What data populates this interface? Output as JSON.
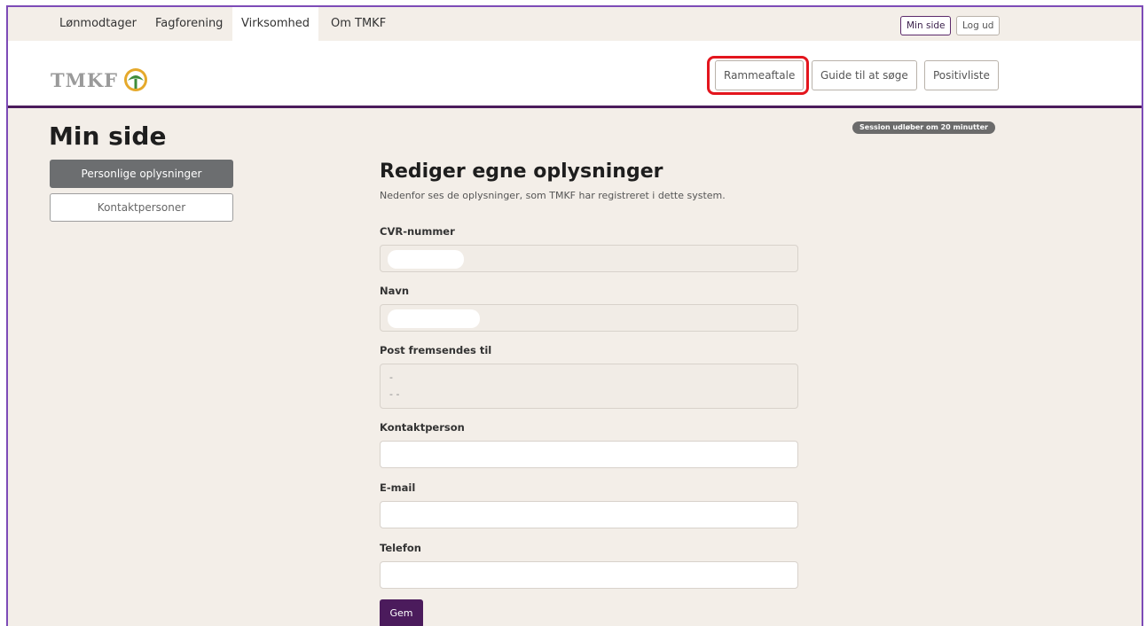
{
  "topnav": {
    "items": [
      {
        "label": "Lønmodtager"
      },
      {
        "label": "Fagforening"
      },
      {
        "label": "Virksomhed",
        "active": true
      },
      {
        "label": "Om TMKF"
      }
    ],
    "min_side": "Min side",
    "log_ud": "Log ud"
  },
  "header": {
    "logo": "TMKF",
    "logo_icon": "tree-icon",
    "buttons": [
      "Rammeaftale",
      "Guide til at søge",
      "Positivliste"
    ]
  },
  "main": {
    "title": "Min side",
    "session_badge": "Session udløber om 20 minutter",
    "sidebar": [
      "Personlige oplysninger",
      "Kontaktpersoner"
    ],
    "form": {
      "title": "Rediger egne oplysninger",
      "intro": "Nedenfor ses de oplysninger, som TMKF har registreret i dette system.",
      "fields": {
        "cvr": {
          "label": "CVR-nummer"
        },
        "navn": {
          "label": "Navn"
        },
        "post": {
          "label": "Post fremsendes til",
          "line1": "-",
          "line2": "- -"
        },
        "kontakt": {
          "label": "Kontaktperson",
          "value": ""
        },
        "email": {
          "label": "E-mail",
          "value": ""
        },
        "telefon": {
          "label": "Telefon",
          "value": ""
        }
      },
      "save": "Gem"
    }
  },
  "colors": {
    "brand_purple": "#4b1b5c",
    "highlight_red": "#e3151d",
    "background": "#f3eee8",
    "logo_green": "#3f8c3a",
    "logo_gold": "#e5a92b"
  }
}
